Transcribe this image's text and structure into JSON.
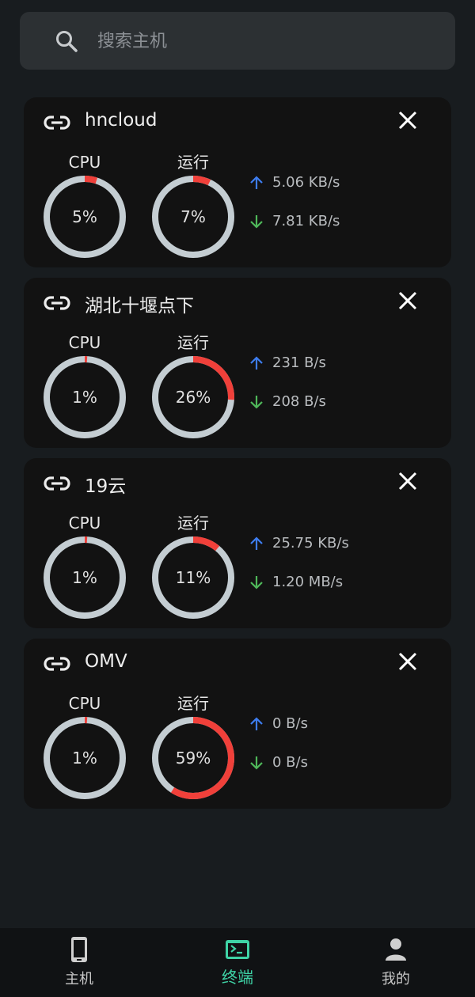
{
  "search": {
    "placeholder": "搜索主机"
  },
  "labels": {
    "cpu": "CPU",
    "run": "运行"
  },
  "colors": {
    "ring_track": "#c4cdd2",
    "ring_fill": "#f0403a",
    "up_arrow": "#3d7df0",
    "down_arrow": "#4fb85a",
    "active_tab": "#3fd3a6"
  },
  "hosts": [
    {
      "name": "hncloud",
      "cpu": 5,
      "cpu_text": "5%",
      "run": 7,
      "run_text": "7%",
      "up": "5.06 KB/s",
      "down": "7.81 KB/s"
    },
    {
      "name": "湖北十堰点下",
      "cpu": 1,
      "cpu_text": "1%",
      "run": 26,
      "run_text": "26%",
      "up": "231 B/s",
      "down": "208 B/s"
    },
    {
      "name": "19云",
      "cpu": 1,
      "cpu_text": "1%",
      "run": 11,
      "run_text": "11%",
      "up": "25.75 KB/s",
      "down": "1.20 MB/s"
    },
    {
      "name": "OMV",
      "cpu": 1,
      "cpu_text": "1%",
      "run": 59,
      "run_text": "59%",
      "up": "0 B/s",
      "down": "0 B/s"
    }
  ],
  "nav": {
    "items": [
      {
        "label": "主机",
        "icon": "phone-icon"
      },
      {
        "label": "终端",
        "icon": "terminal-icon"
      },
      {
        "label": "我的",
        "icon": "person-icon"
      }
    ],
    "active": 1
  }
}
